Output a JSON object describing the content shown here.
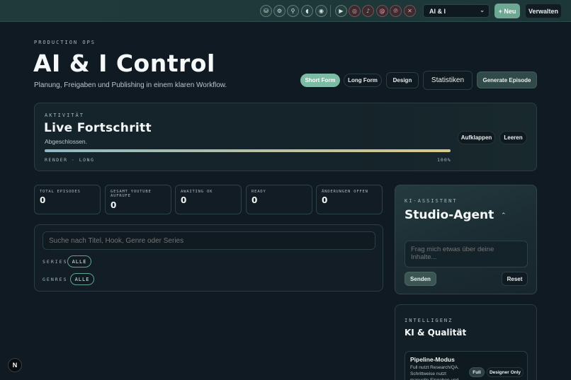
{
  "topbar": {
    "icons": [
      {
        "name": "database-icon",
        "glyph": "⛁"
      },
      {
        "name": "gear-icon",
        "glyph": "⚙"
      },
      {
        "name": "network-icon",
        "glyph": "⚲"
      },
      {
        "name": "audio-icon",
        "glyph": "◖"
      },
      {
        "name": "mic-icon",
        "glyph": "◉"
      },
      {
        "name": "youtube-icon",
        "glyph": "▶"
      },
      {
        "name": "instagram-icon",
        "glyph": "◎"
      },
      {
        "name": "tiktok-icon",
        "glyph": "♪"
      },
      {
        "name": "threads-icon",
        "glyph": "@"
      },
      {
        "name": "pinterest-icon",
        "glyph": "℗"
      },
      {
        "name": "x-icon",
        "glyph": "✕"
      }
    ],
    "project_select": "AI & I",
    "new_label": "+ Neu",
    "manage_label": "Verwalten"
  },
  "hero": {
    "eyebrow": "PRODUCTION OPS",
    "title": "AI & I Control",
    "subtitle": "Planung, Freigaben und Publishing in einem klaren Workflow."
  },
  "format_tabs": {
    "short_form": "Short Form",
    "long_form": "Long Form",
    "design": "Design",
    "stats": "Statistiken",
    "generate": "Generate Episode"
  },
  "activity": {
    "eyebrow": "AKTIVITÄT",
    "title": "Live Fortschritt",
    "status": "Abgeschlossen.",
    "expand_label": "Aufklappen",
    "clear_label": "Leeren",
    "progress_label": "RENDER · LONG",
    "progress_percent_label": "100%",
    "progress_value": 1.0
  },
  "stats": [
    {
      "label": "TOTAL EPISODES",
      "value": "0"
    },
    {
      "label": "GESAMT YOUTUBE AUFRUFE",
      "value": "0"
    },
    {
      "label": "AWAITING OK",
      "value": "0"
    },
    {
      "label": "READY",
      "value": "0"
    },
    {
      "label": "ÄNDERUNGEN OFFEN",
      "value": "0"
    }
  ],
  "filters": {
    "search_placeholder": "Suche nach Titel, Hook, Genre oder Series",
    "series_label": "SERIES",
    "series_value": "ALLE",
    "genres_label": "GENRES",
    "genres_value": "ALLE"
  },
  "assistant": {
    "eyebrow": "KI-ASSISTENT",
    "title": "Studio-Agent",
    "input_placeholder": "Frag mich etwas über deine Inhalte...",
    "send_label": "Senden",
    "reset_label": "Reset"
  },
  "intelligence": {
    "eyebrow": "INTELLIGENZ",
    "title": "KI & Qualität",
    "pipeline_title": "Pipeline-Modus",
    "pipeline_desc": "Full nutzt Research/QA. Schrittweise nutzt manuelle Eingaben und",
    "full_label": "Full",
    "designer_label": "Designer Only"
  },
  "badge": "N",
  "colors": {
    "accent": "#7cbca4",
    "background": "#0f1a22",
    "progress_start": "#8fb9c4",
    "progress_end": "#d9c98a"
  }
}
